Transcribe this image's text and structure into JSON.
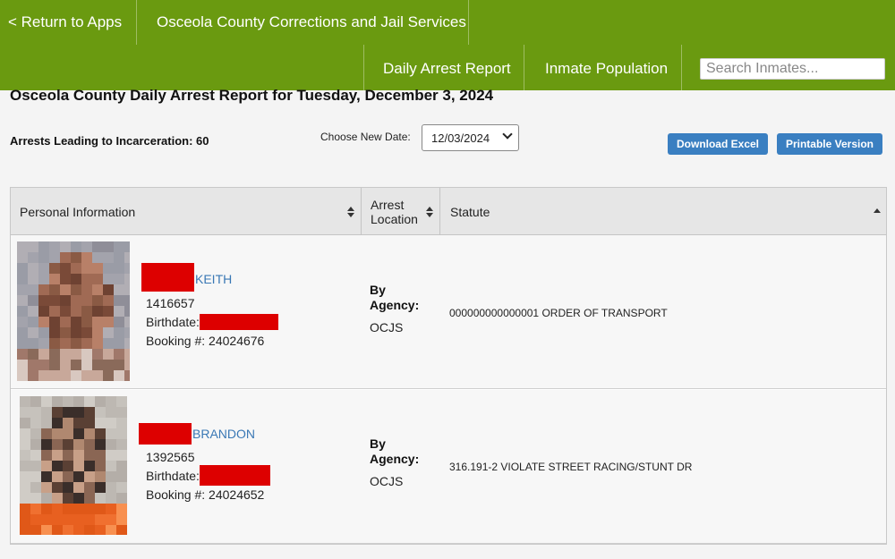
{
  "nav": {
    "back_label": "< Return to Apps",
    "site_title": "Osceola County Corrections and Jail Services",
    "daily_arrest": "Daily Arrest Report",
    "inmate_population": "Inmate Population",
    "search_placeholder": "Search Inmates..."
  },
  "page": {
    "title": "Osceola County Daily Arrest Report for Tuesday, December 3, 2024",
    "arrests_label": "Arrests Leading to Incarceration: 60",
    "choose_date_label": "Choose New Date:",
    "selected_date": "12/03/2024",
    "download_excel": "Download Excel",
    "printable_version": "Printable Version"
  },
  "table": {
    "headers": [
      "Personal Information",
      "Arrest Location",
      "Statute"
    ],
    "rows": [
      {
        "name": "KEITH",
        "id": "1416657",
        "birthdate_label": "Birthdate:",
        "booking": "Booking #: 24024676",
        "agency_label": "By Agency:",
        "agency": "OCJS",
        "statute": "000000000000001 ORDER OF TRANSPORT"
      },
      {
        "name": "BRANDON",
        "id": "1392565",
        "birthdate_label": "Birthdate:",
        "booking": "Booking #: 24024652",
        "agency_label": "By Agency:",
        "agency": "OCJS",
        "statute": "316.191-2 VIOLATE STREET RACING/STUNT DR"
      }
    ]
  },
  "colors": {
    "nav_green": "#6a9a10",
    "button_blue": "#3a7fc1",
    "link_blue": "#3a78b5",
    "redaction_red": "#dd0000"
  }
}
